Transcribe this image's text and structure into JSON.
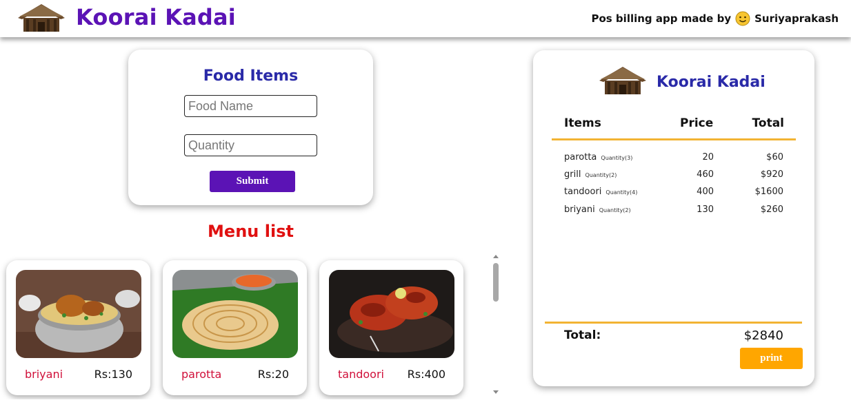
{
  "header": {
    "brand": "Koorai Kadai",
    "credit_prefix": "Pos billing app made by",
    "credit_name": "Suriyaprakash"
  },
  "form": {
    "title": "Food Items",
    "food_name_placeholder": "Food Name",
    "quantity_placeholder": "Quantity",
    "submit_label": "Submit"
  },
  "menu": {
    "title": "Menu list",
    "items": [
      {
        "name": "briyani",
        "price": "Rs:130"
      },
      {
        "name": "parotta",
        "price": "Rs:20"
      },
      {
        "name": "tandoori",
        "price": "Rs:400"
      }
    ]
  },
  "bill": {
    "brand": "Koorai Kadai",
    "headers": {
      "items": "Items",
      "price": "Price",
      "total": "Total"
    },
    "rows": [
      {
        "item": "parotta",
        "qty": "Quantity(3)",
        "price": "20",
        "total": "$60"
      },
      {
        "item": "grill",
        "qty": "Quantity(2)",
        "price": "460",
        "total": "$920"
      },
      {
        "item": "tandoori",
        "qty": "Quantity(4)",
        "price": "400",
        "total": "$1600"
      },
      {
        "item": "briyani",
        "qty": "Quantity(2)",
        "price": "130",
        "total": "$260"
      }
    ],
    "total_label": "Total:",
    "total_value": "$2840",
    "print_label": "print"
  },
  "colors": {
    "brand_purple": "#5b13b5",
    "title_blue": "#2a2aa8",
    "menu_red": "#e01010",
    "accent_orange": "#ffa600",
    "divider_yellow": "#f2b333"
  },
  "icons": {
    "logo": "hut-logo-icon",
    "smile": "smiley-face-icon"
  }
}
